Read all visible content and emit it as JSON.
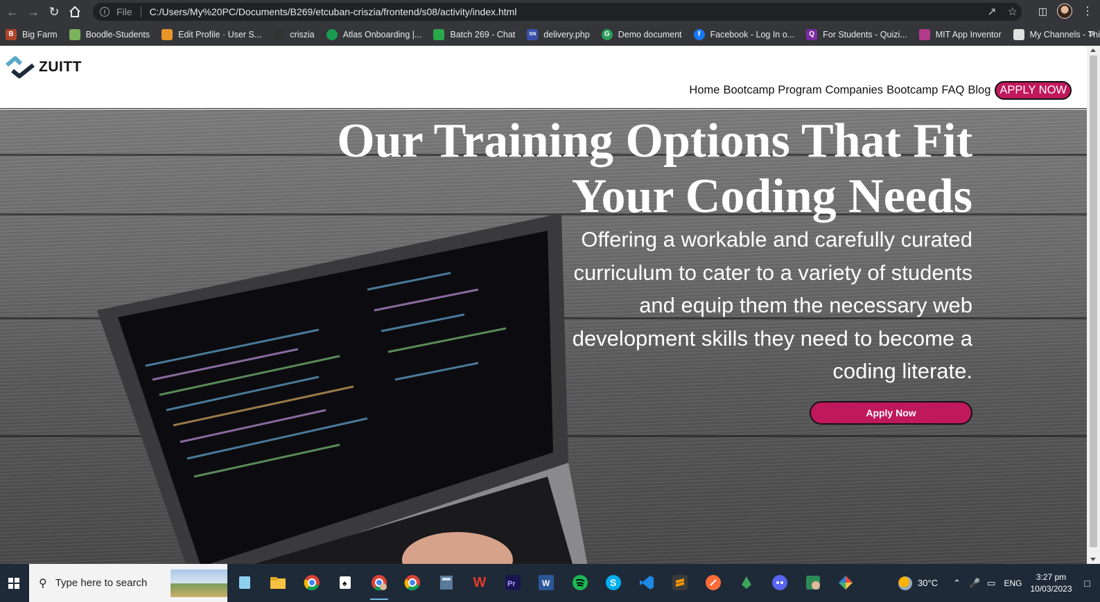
{
  "browser": {
    "file_label": "File",
    "url": "C:/Users/My%20PC/Documents/B269/etcuban-criszia/frontend/s08/activity/index.html"
  },
  "bookmarks": [
    {
      "label": "Big Farm",
      "color": "#b0442a"
    },
    {
      "label": "Boodle-Students",
      "color": "#7bb35c"
    },
    {
      "label": "Edit Profile · User S...",
      "color": "#e8962a"
    },
    {
      "label": "criszia",
      "color": "#333333"
    },
    {
      "label": "Atlas Onboarding |...",
      "color": "#1a9b53"
    },
    {
      "label": "Batch 269 - Chat",
      "color": "#2aa84a"
    },
    {
      "label": "delivery.php",
      "color": "#3a50a8"
    },
    {
      "label": "Demo document",
      "color": "#2a9d5a"
    },
    {
      "label": "Facebook - Log In o...",
      "color": "#1877f2"
    },
    {
      "label": "For Students - Quizi...",
      "color": "#7a2aa0"
    },
    {
      "label": "MIT App Inventor",
      "color": "#b03a8a"
    },
    {
      "label": "My Channels - Thin...",
      "color": "#e0e0e0"
    }
  ],
  "site": {
    "logo_text": "ZUITT",
    "nav": [
      "Home",
      "Bootcamp Program",
      "Companies",
      "Bootcamp",
      "FAQ",
      "Blog"
    ],
    "nav_cta": "APPLY NOW",
    "accent": "#c0185c"
  },
  "hero": {
    "title_line1": "Our Training Options That Fit",
    "title_line2": "Your Coding Needs",
    "subtitle": "Offering a workable and carefully curated curriculum to cater to a variety of students and equip them the necessary web development skills they need to become a coding literate.",
    "cta": "Apply Now"
  },
  "taskbar": {
    "search_placeholder": "Type here to search",
    "weather": "30°C",
    "language": "ENG",
    "time": "3:27 pm",
    "date": "10/03/2023",
    "apps": [
      "notepad-icon",
      "file-explorer-icon",
      "chrome-icon",
      "solitaire-icon",
      "chrome-profile-icon",
      "chrome-icon",
      "calculator-icon",
      "wps-icon",
      "premiere-icon",
      "word-icon",
      "spotify-icon",
      "skype-icon",
      "vscode-icon",
      "sublime-icon",
      "postman-icon",
      "robo-icon",
      "discord-icon",
      "app-icon",
      "git-icon"
    ]
  }
}
